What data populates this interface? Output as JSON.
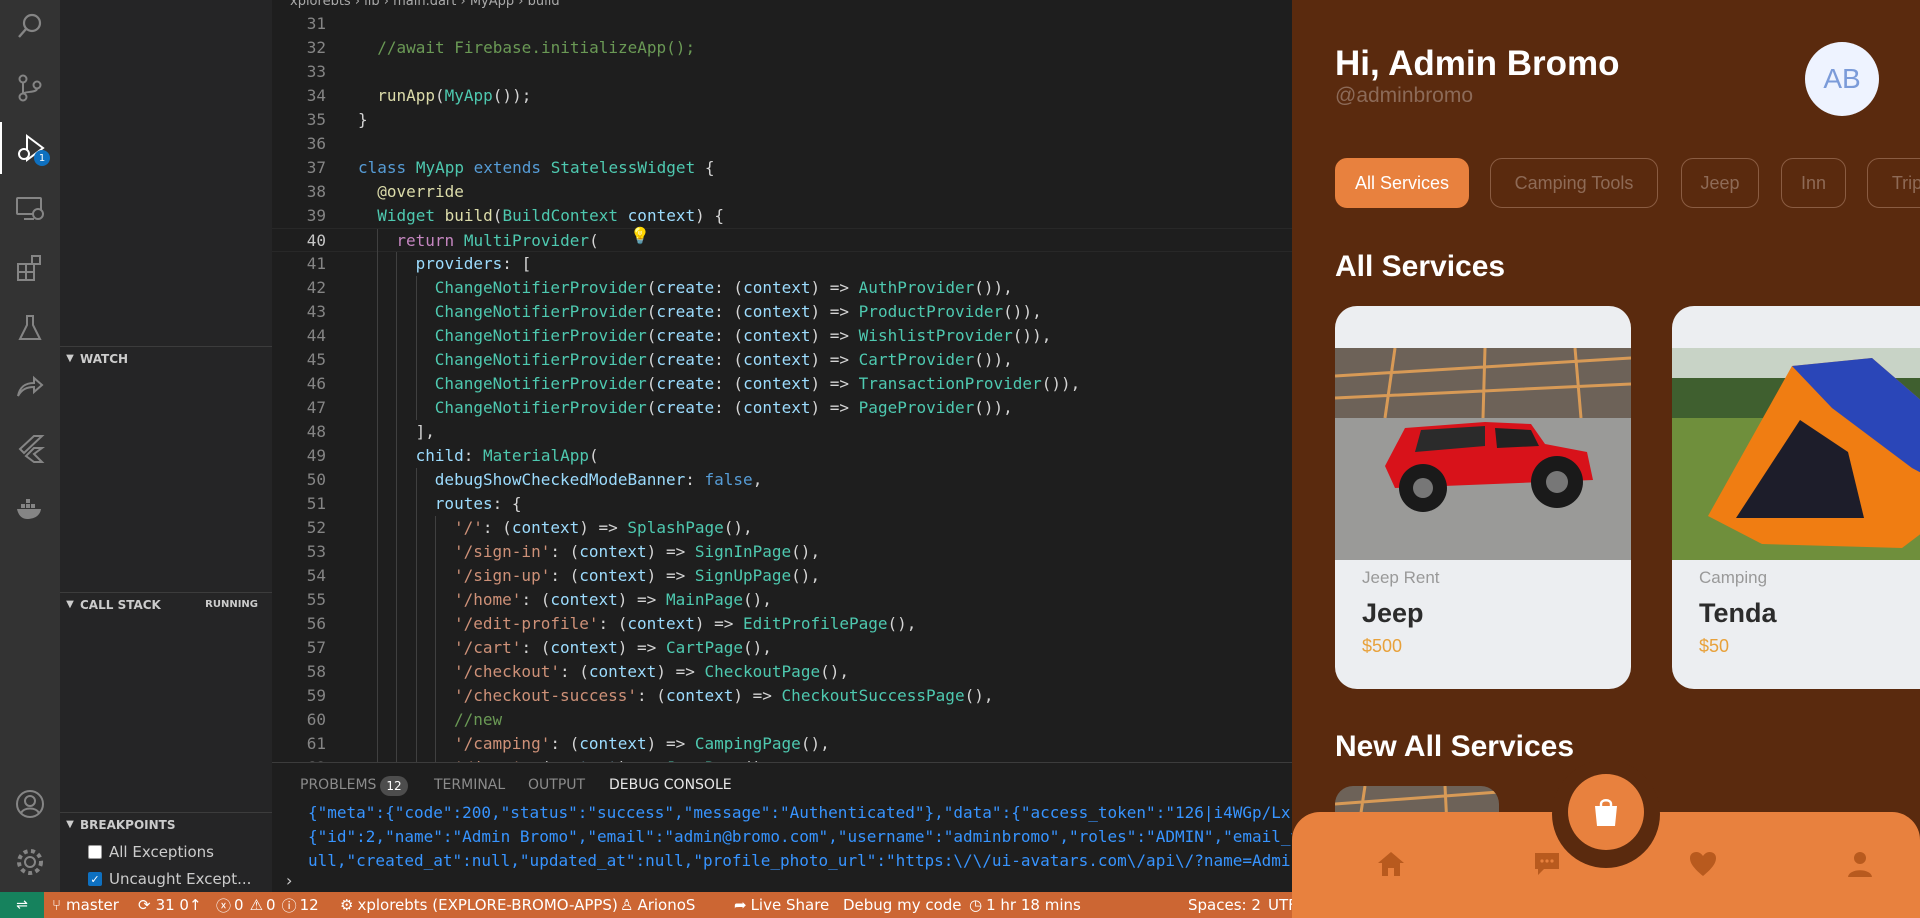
{
  "activity_bar": {
    "icons": [
      "search-icon",
      "source-control-icon",
      "run-debug-icon",
      "remote-explorer-icon",
      "extensions-icon",
      "testing-icon",
      "live-share-icon",
      "flutter-icon",
      "docker-icon",
      "accounts-icon",
      "settings-gear-icon"
    ],
    "debug_badge": "1"
  },
  "sidebar": {
    "watch_title": "WATCH",
    "callstack_title": "CALL STACK",
    "callstack_status": "RUNNING",
    "breakpoints_title": "BREAKPOINTS",
    "breakpoints": [
      {
        "label": "All Exceptions",
        "checked": false
      },
      {
        "label": "Uncaught Except...",
        "checked": true
      }
    ]
  },
  "editor": {
    "current_line": 40,
    "lines": [
      {
        "n": "31",
        "indent": 0,
        "tokens": []
      },
      {
        "n": "32",
        "indent": 1,
        "tokens": [
          [
            "cm",
            "//await Firebase.initializeApp();"
          ]
        ]
      },
      {
        "n": "33",
        "indent": 0,
        "tokens": []
      },
      {
        "n": "34",
        "indent": 1,
        "tokens": [
          [
            "fn",
            "runApp"
          ],
          [
            "",
            "("
          ],
          [
            "ty",
            "MyApp"
          ],
          [
            "",
            "());"
          ]
        ]
      },
      {
        "n": "35",
        "indent": 0,
        "tokens": [
          [
            "",
            "}"
          ]
        ]
      },
      {
        "n": "36",
        "indent": 0,
        "tokens": []
      },
      {
        "n": "37",
        "indent": 0,
        "tokens": [
          [
            "kw",
            "class"
          ],
          [
            "",
            " "
          ],
          [
            "ty",
            "MyApp"
          ],
          [
            "",
            " "
          ],
          [
            "kw",
            "extends"
          ],
          [
            "",
            " "
          ],
          [
            "ty",
            "StatelessWidget"
          ],
          [
            "",
            " {"
          ]
        ]
      },
      {
        "n": "38",
        "indent": 1,
        "tokens": [
          [
            "fn",
            "@override"
          ]
        ]
      },
      {
        "n": "39",
        "indent": 1,
        "tokens": [
          [
            "ty",
            "Widget"
          ],
          [
            "",
            " "
          ],
          [
            "fn",
            "build"
          ],
          [
            "",
            "("
          ],
          [
            "ty",
            "BuildContext"
          ],
          [
            "",
            " "
          ],
          [
            "pm",
            "context"
          ],
          [
            "",
            ") {"
          ]
        ]
      },
      {
        "n": "40",
        "indent": 2,
        "tokens": [
          [
            "ct",
            "return"
          ],
          [
            "",
            " "
          ],
          [
            "ty",
            "MultiProvider"
          ],
          [
            "",
            "("
          ]
        ]
      },
      {
        "n": "41",
        "indent": 3,
        "tokens": [
          [
            "pm",
            "providers"
          ],
          [
            "",
            ": ["
          ]
        ]
      },
      {
        "n": "42",
        "indent": 4,
        "tokens": [
          [
            "ty",
            "ChangeNotifierProvider"
          ],
          [
            "",
            "("
          ],
          [
            "pm",
            "create"
          ],
          [
            "",
            ": ("
          ],
          [
            "pm",
            "context"
          ],
          [
            "",
            ") => "
          ],
          [
            "ty",
            "AuthProvider"
          ],
          [
            "",
            "()),"
          ]
        ]
      },
      {
        "n": "43",
        "indent": 4,
        "tokens": [
          [
            "ty",
            "ChangeNotifierProvider"
          ],
          [
            "",
            "("
          ],
          [
            "pm",
            "create"
          ],
          [
            "",
            ": ("
          ],
          [
            "pm",
            "context"
          ],
          [
            "",
            ") => "
          ],
          [
            "ty",
            "ProductProvider"
          ],
          [
            "",
            "()),"
          ]
        ]
      },
      {
        "n": "44",
        "indent": 4,
        "tokens": [
          [
            "ty",
            "ChangeNotifierProvider"
          ],
          [
            "",
            "("
          ],
          [
            "pm",
            "create"
          ],
          [
            "",
            ": ("
          ],
          [
            "pm",
            "context"
          ],
          [
            "",
            ") => "
          ],
          [
            "ty",
            "WishlistProvider"
          ],
          [
            "",
            "()),"
          ]
        ]
      },
      {
        "n": "45",
        "indent": 4,
        "tokens": [
          [
            "ty",
            "ChangeNotifierProvider"
          ],
          [
            "",
            "("
          ],
          [
            "pm",
            "create"
          ],
          [
            "",
            ": ("
          ],
          [
            "pm",
            "context"
          ],
          [
            "",
            ") => "
          ],
          [
            "ty",
            "CartProvider"
          ],
          [
            "",
            "()),"
          ]
        ]
      },
      {
        "n": "46",
        "indent": 4,
        "tokens": [
          [
            "ty",
            "ChangeNotifierProvider"
          ],
          [
            "",
            "("
          ],
          [
            "pm",
            "create"
          ],
          [
            "",
            ": ("
          ],
          [
            "pm",
            "context"
          ],
          [
            "",
            ") => "
          ],
          [
            "ty",
            "TransactionProvider"
          ],
          [
            "",
            "()),"
          ]
        ]
      },
      {
        "n": "47",
        "indent": 4,
        "tokens": [
          [
            "ty",
            "ChangeNotifierProvider"
          ],
          [
            "",
            "("
          ],
          [
            "pm",
            "create"
          ],
          [
            "",
            ": ("
          ],
          [
            "pm",
            "context"
          ],
          [
            "",
            ") => "
          ],
          [
            "ty",
            "PageProvider"
          ],
          [
            "",
            "()),"
          ]
        ]
      },
      {
        "n": "48",
        "indent": 3,
        "tokens": [
          [
            "",
            "],"
          ]
        ]
      },
      {
        "n": "49",
        "indent": 3,
        "tokens": [
          [
            "pm",
            "child"
          ],
          [
            "",
            ": "
          ],
          [
            "ty",
            "MaterialApp"
          ],
          [
            "",
            "("
          ]
        ]
      },
      {
        "n": "50",
        "indent": 4,
        "tokens": [
          [
            "pm",
            "debugShowCheckedModeBanner"
          ],
          [
            "",
            ": "
          ],
          [
            "kw",
            "false"
          ],
          [
            "",
            ","
          ]
        ]
      },
      {
        "n": "51",
        "indent": 4,
        "tokens": [
          [
            "pm",
            "routes"
          ],
          [
            "",
            ": {"
          ]
        ]
      },
      {
        "n": "52",
        "indent": 5,
        "tokens": [
          [
            "st",
            "'/'"
          ],
          [
            "",
            ": ("
          ],
          [
            "pm",
            "context"
          ],
          [
            "",
            ") => "
          ],
          [
            "ty",
            "SplashPage"
          ],
          [
            "",
            "(),"
          ]
        ]
      },
      {
        "n": "53",
        "indent": 5,
        "tokens": [
          [
            "st",
            "'/sign-in'"
          ],
          [
            "",
            ": ("
          ],
          [
            "pm",
            "context"
          ],
          [
            "",
            ") => "
          ],
          [
            "ty",
            "SignInPage"
          ],
          [
            "",
            "(),"
          ]
        ]
      },
      {
        "n": "54",
        "indent": 5,
        "tokens": [
          [
            "st",
            "'/sign-up'"
          ],
          [
            "",
            ": ("
          ],
          [
            "pm",
            "context"
          ],
          [
            "",
            ") => "
          ],
          [
            "ty",
            "SignUpPage"
          ],
          [
            "",
            "(),"
          ]
        ]
      },
      {
        "n": "55",
        "indent": 5,
        "tokens": [
          [
            "st",
            "'/home'"
          ],
          [
            "",
            ": ("
          ],
          [
            "pm",
            "context"
          ],
          [
            "",
            ") => "
          ],
          [
            "ty",
            "MainPage"
          ],
          [
            "",
            "(),"
          ]
        ]
      },
      {
        "n": "56",
        "indent": 5,
        "tokens": [
          [
            "st",
            "'/edit-profile'"
          ],
          [
            "",
            ": ("
          ],
          [
            "pm",
            "context"
          ],
          [
            "",
            ") => "
          ],
          [
            "ty",
            "EditProfilePage"
          ],
          [
            "",
            "(),"
          ]
        ]
      },
      {
        "n": "57",
        "indent": 5,
        "tokens": [
          [
            "st",
            "'/cart'"
          ],
          [
            "",
            ": ("
          ],
          [
            "pm",
            "context"
          ],
          [
            "",
            ") => "
          ],
          [
            "ty",
            "CartPage"
          ],
          [
            "",
            "(),"
          ]
        ]
      },
      {
        "n": "58",
        "indent": 5,
        "tokens": [
          [
            "st",
            "'/checkout'"
          ],
          [
            "",
            ": ("
          ],
          [
            "pm",
            "context"
          ],
          [
            "",
            ") => "
          ],
          [
            "ty",
            "CheckoutPage"
          ],
          [
            "",
            "(),"
          ]
        ]
      },
      {
        "n": "59",
        "indent": 5,
        "tokens": [
          [
            "st",
            "'/checkout-success'"
          ],
          [
            "",
            ": ("
          ],
          [
            "pm",
            "context"
          ],
          [
            "",
            ") => "
          ],
          [
            "ty",
            "CheckoutSuccessPage"
          ],
          [
            "",
            "(),"
          ]
        ]
      },
      {
        "n": "60",
        "indent": 5,
        "tokens": [
          [
            "cm",
            "//new"
          ]
        ]
      },
      {
        "n": "61",
        "indent": 5,
        "tokens": [
          [
            "st",
            "'/camping'"
          ],
          [
            "",
            ": ("
          ],
          [
            "pm",
            "context"
          ],
          [
            "",
            ") => "
          ],
          [
            "ty",
            "CampingPage"
          ],
          [
            "",
            "(),"
          ]
        ]
      },
      {
        "n": "62",
        "indent": 5,
        "tokens": [
          [
            "st",
            "'/jeep'"
          ],
          [
            "",
            ": ("
          ],
          [
            "pm",
            "context"
          ],
          [
            "",
            ") => "
          ],
          [
            "ty",
            "JeepPage"
          ],
          [
            "",
            "()"
          ]
        ]
      }
    ]
  },
  "panel": {
    "tabs": [
      "PROBLEMS",
      "TERMINAL",
      "OUTPUT",
      "DEBUG CONSOLE"
    ],
    "active_tab": "DEBUG CONSOLE",
    "problems_count": "12",
    "console_lines": [
      "{\"meta\":{\"code\":200,\"status\":\"success\",\"message\":\"Authenticated\"},\"data\":{\"access_token\":\"126|i4WGp/Lx",
      "{\"id\":2,\"name\":\"Admin Bromo\",\"email\":\"admin@bromo.com\",\"username\":\"adminbromo\",\"roles\":\"ADMIN\",\"email_v",
      "ull,\"created_at\":null,\"updated_at\":null,\"profile_photo_url\":\"https:\\/\\/ui-avatars.com\\/api\\/?name=Admi"
    ],
    "prompt": "›"
  },
  "status_bar": {
    "branch": "master",
    "sync": "31 0↑",
    "errors": "0",
    "warnings": "0",
    "infos": "12",
    "workspace": "xplorebts (EXPLORE-BROMO-APPS)",
    "user": "ArionoS",
    "live_share": "Live Share",
    "debug_code": "Debug my code",
    "time": "1 hr 18 mins",
    "spaces": "Spaces: 2",
    "encoding": "UTF"
  },
  "app": {
    "greeting": "Hi, Admin Bromo",
    "username": "@adminbromo",
    "avatar_initials": "AB",
    "categories": [
      "All Services",
      "Camping Tools",
      "Jeep",
      "Inn",
      "Trip"
    ],
    "active_category": "All Services",
    "section_title": "All Services",
    "products": [
      {
        "category": "Jeep Rent",
        "name": "Jeep",
        "price": "$500"
      },
      {
        "category": "Camping",
        "name": "Tenda",
        "price": "$50"
      }
    ],
    "new_section_title": "New All Services",
    "nav_icons": [
      "home-icon",
      "chat-icon",
      "heart-icon",
      "profile-icon"
    ],
    "accent_color": "#e8813e",
    "background_color": "#5a2a0e"
  }
}
